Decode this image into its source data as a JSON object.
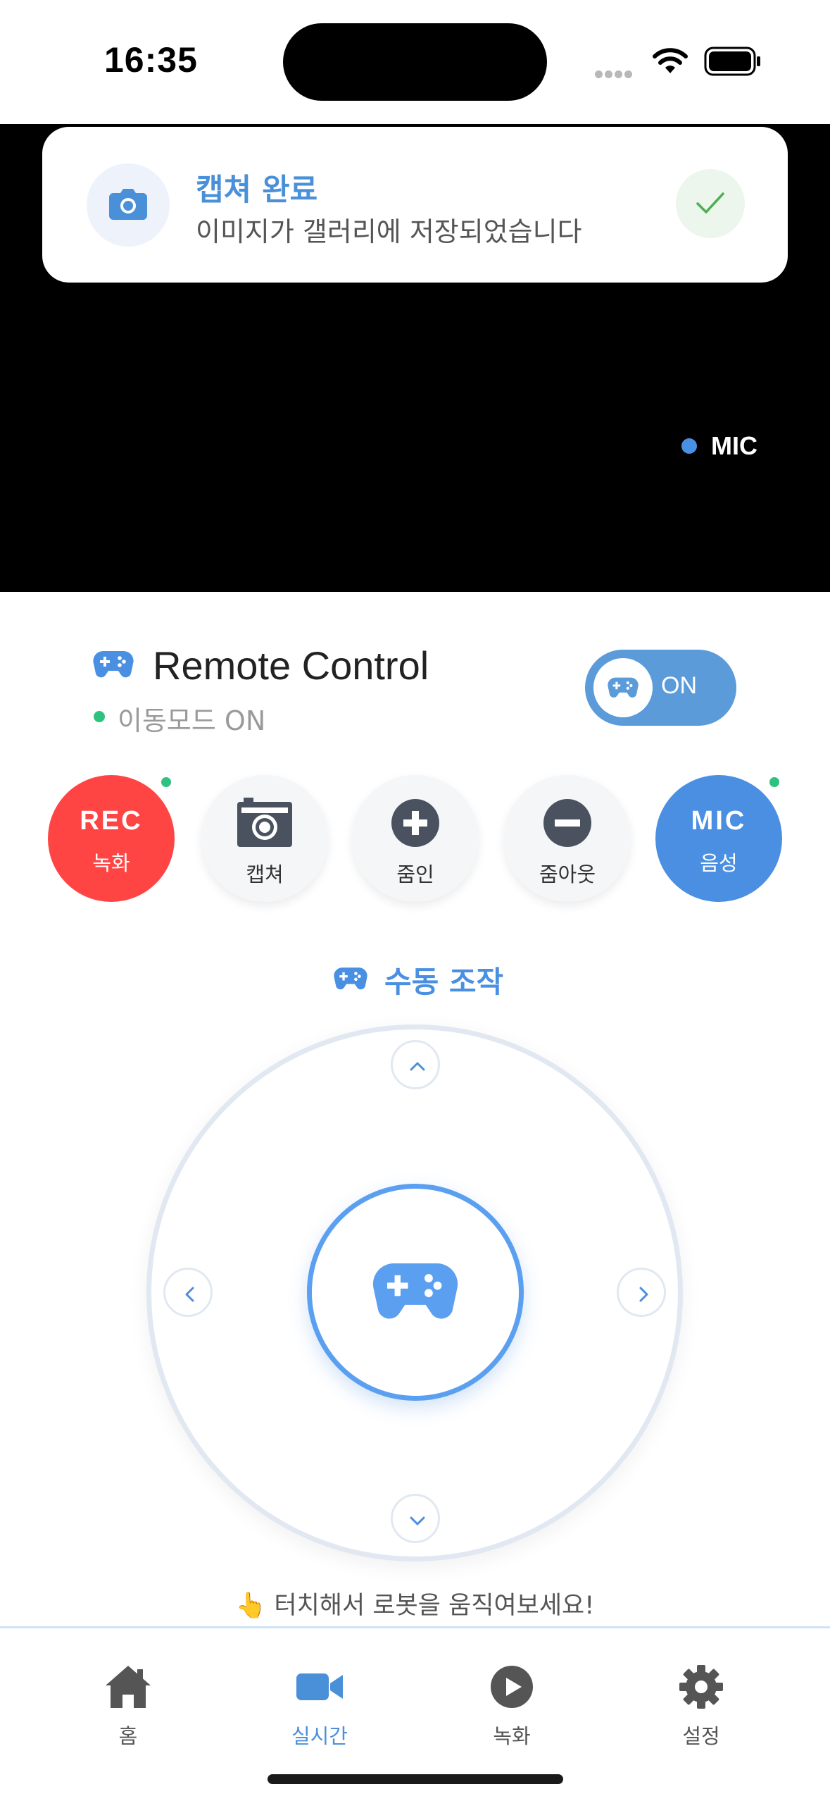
{
  "status_bar": {
    "time": "16:35"
  },
  "toast": {
    "title": "캡쳐 완료",
    "message": "이미지가 갤러리에 저장되었습니다"
  },
  "video": {
    "mic_label": "MIC"
  },
  "remote_control": {
    "title": "Remote Control",
    "mode_text": "이동모드 ON",
    "toggle_label": "ON"
  },
  "quick_actions": {
    "rec": {
      "big": "REC",
      "small": "녹화",
      "color": "#ff4444"
    },
    "capture": {
      "label": "캡쳐"
    },
    "zoom_in": {
      "label": "줌인"
    },
    "zoom_out": {
      "label": "줌아웃"
    },
    "mic": {
      "big": "MIC",
      "small": "음성",
      "color": "#4a8fe2"
    }
  },
  "manual_control": {
    "title": "수동 조작"
  },
  "hint": "👆 터치해서 로봇을 움직여보세요!",
  "tabs": [
    {
      "label": "홈",
      "icon": "home-icon"
    },
    {
      "label": "실시간",
      "icon": "video-camera-icon",
      "active": true
    },
    {
      "label": "녹화",
      "icon": "play-icon"
    },
    {
      "label": "설정",
      "icon": "gear-icon"
    }
  ],
  "colors": {
    "accent": "#4a90e2",
    "success": "#2ec27e",
    "record": "#ff4444"
  }
}
